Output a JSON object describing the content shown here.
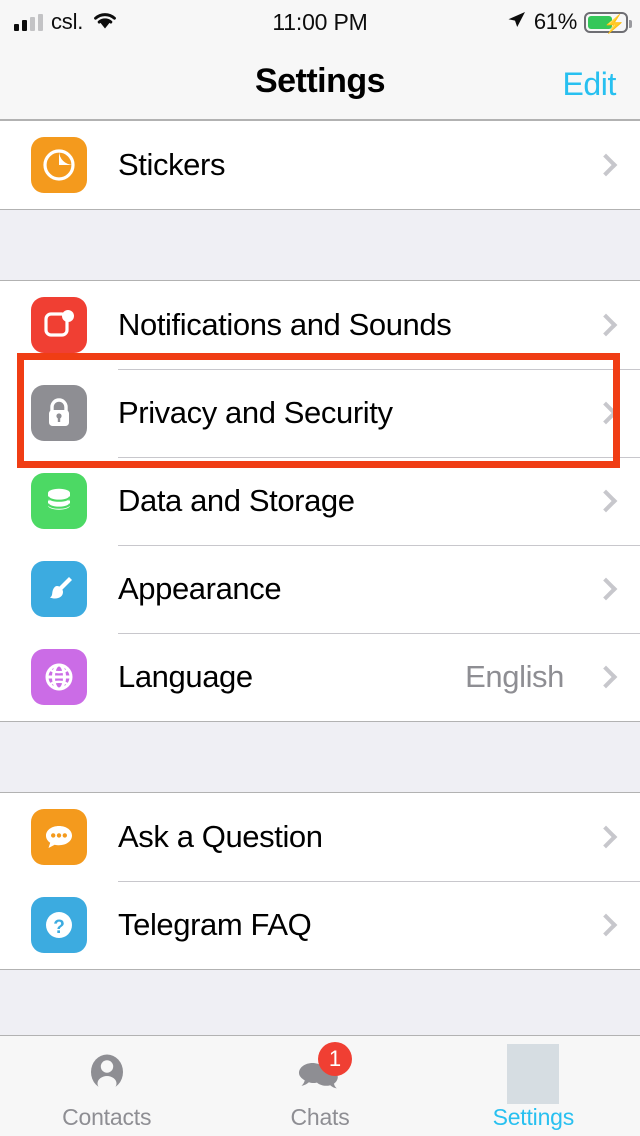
{
  "status_bar": {
    "carrier": "csl.",
    "wifi_icon": "wifi-icon",
    "time": "11:00 PM",
    "location_icon": "location-arrow-icon",
    "battery_percent": "61%",
    "battery_level": 61,
    "charging": true
  },
  "header": {
    "title": "Settings",
    "edit_label": "Edit"
  },
  "groups": [
    {
      "rows": [
        {
          "label": "Stickers",
          "icon": "stickers-icon",
          "icon_color": "#f49a1d",
          "value": "",
          "chevron": true
        }
      ]
    },
    {
      "rows": [
        {
          "label": "Notifications and Sounds",
          "icon": "notifications-icon",
          "icon_color": "#f03f33",
          "value": "",
          "chevron": true
        },
        {
          "label": "Privacy and Security",
          "icon": "lock-icon",
          "icon_color": "#8e8e93",
          "value": "",
          "chevron": true
        },
        {
          "label": "Data and Storage",
          "icon": "database-icon",
          "icon_color": "#4cd964",
          "value": "",
          "chevron": true
        },
        {
          "label": "Appearance",
          "icon": "paintbrush-icon",
          "icon_color": "#3cabe0",
          "value": "",
          "chevron": true
        },
        {
          "label": "Language",
          "icon": "globe-icon",
          "icon_color": "#cb6ce6",
          "value": "English",
          "chevron": true
        }
      ]
    },
    {
      "rows": [
        {
          "label": "Ask a Question",
          "icon": "chat-bubble-icon",
          "icon_color": "#f49a1d",
          "value": "",
          "chevron": true
        },
        {
          "label": "Telegram FAQ",
          "icon": "question-mark-icon",
          "icon_color": "#3cabe0",
          "value": "",
          "chevron": true
        }
      ]
    }
  ],
  "highlight": {
    "target_row": "Privacy and Security",
    "color": "#f03d14"
  },
  "tab_bar": {
    "tabs": [
      {
        "label": "Contacts",
        "icon": "person-icon",
        "active": false,
        "badge": ""
      },
      {
        "label": "Chats",
        "icon": "chats-icon",
        "active": false,
        "badge": "1"
      },
      {
        "label": "Settings",
        "icon": "settings-placeholder-icon",
        "active": true,
        "badge": ""
      }
    ],
    "active_color": "#28c0f0",
    "inactive_color": "#8e8e93"
  }
}
